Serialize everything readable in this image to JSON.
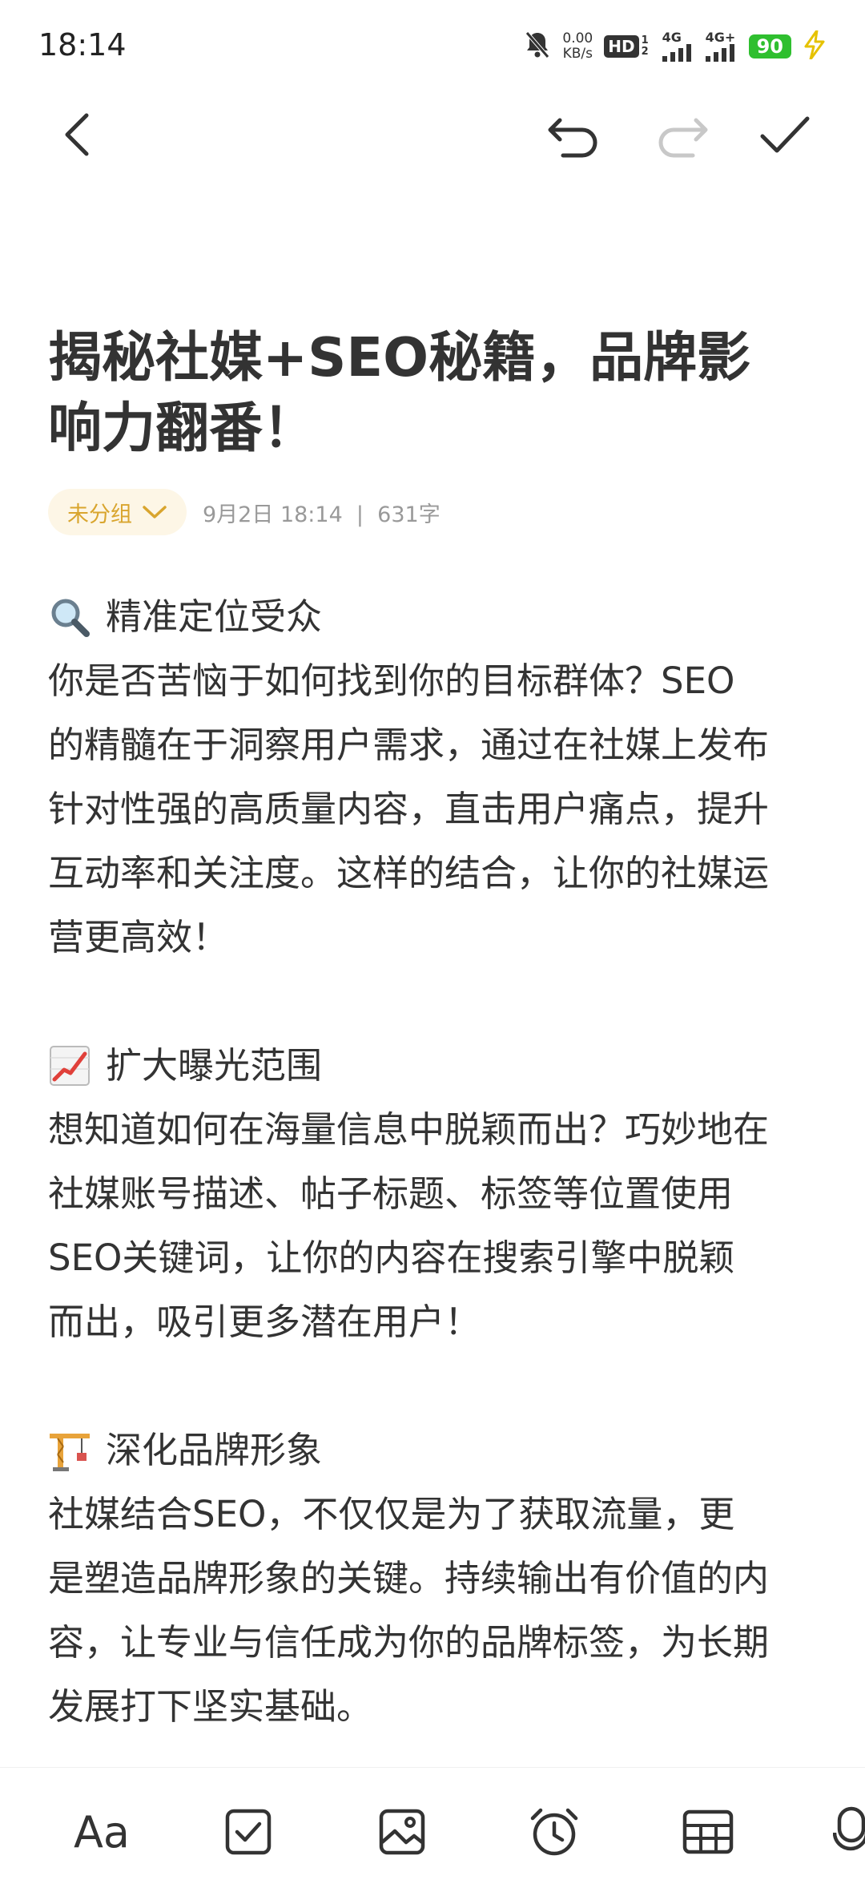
{
  "status_bar": {
    "time": "18:14",
    "net_speed_value": "0.00",
    "net_speed_unit": "KB/s",
    "hd_label": "HD",
    "hd_slots": "1 2",
    "signal1_label": "4G",
    "signal2_label": "4G+",
    "battery_level": "90"
  },
  "toolbar": {
    "back": "back-icon",
    "undo": "undo-icon",
    "redo": "redo-icon",
    "done": "checkmark-icon"
  },
  "note": {
    "title_line1": "揭秘社媒+SEO秘籍，品牌影",
    "title_line2": "响力翻番！",
    "group_label": "未分组",
    "meta": "9月2日 18:14  |  631字",
    "sections": [
      {
        "emoji": "magnifier-emoji",
        "heading": "精准定位受众",
        "lines": [
          "你是否苦恼于如何找到你的目标群体？SEO",
          "的精髓在于洞察用户需求，通过在社媒上发布",
          "针对性强的高质量内容，直击用户痛点，提升",
          "互动率和关注度。这样的结合，让你的社媒运",
          "营更高效！"
        ]
      },
      {
        "emoji": "chart-increasing-emoji",
        "heading": "扩大曝光范围",
        "lines": [
          "想知道如何在海量信息中脱颖而出？巧妙地在",
          "社媒账号描述、帖子标题、标签等位置使用",
          "SEO关键词，让你的内容在搜索引擎中脱颖",
          "而出，吸引更多潜在用户！"
        ]
      },
      {
        "emoji": "construction-crane-emoji",
        "heading": "深化品牌形象",
        "lines": [
          "社媒结合SEO，不仅仅是为了获取流量，更",
          "是塑造品牌形象的关键。持续输出有价值的内",
          "容，让专业与信任成为你的品牌标签，为长期",
          "发展打下坚实基础。"
        ]
      }
    ]
  },
  "bottom_bar": {
    "text_style_label": "Aa",
    "checklist": "checkbox-icon",
    "image": "image-icon",
    "reminder": "alarm-clock-icon",
    "table": "table-icon",
    "voice": "microphone-icon"
  }
}
